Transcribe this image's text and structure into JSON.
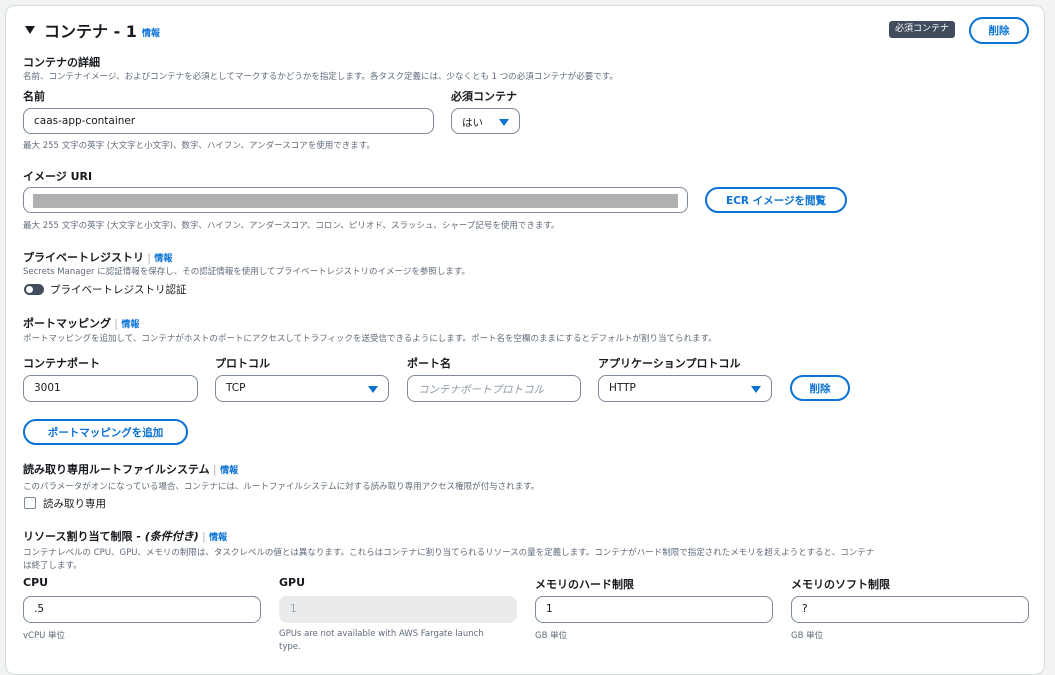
{
  "header": {
    "title": "コンテナ - 1",
    "info": "情報",
    "badge": "必須コンテナ",
    "delete_label": "削除"
  },
  "details": {
    "title": "コンテナの詳細",
    "description": "名前、コンテナイメージ、およびコンテナを必須としてマークするかどうかを指定します。各タスク定義には、少なくとも 1 つの必須コンテナが必要です。"
  },
  "name": {
    "label": "名前",
    "value": "caas-app-container",
    "hint": "最大 255 文字の英字 (大文字と小文字)、数字、ハイフン、アンダースコアを使用できます。"
  },
  "essential": {
    "label": "必須コンテナ",
    "value": "はい"
  },
  "image": {
    "label": "イメージ URI",
    "browse_label": "ECR イメージを閲覧",
    "hint": "最大 255 文字の英字 (大文字と小文字)、数字、ハイフン、アンダースコア、コロン、ピリオド、スラッシュ、シャープ記号を使用できます。"
  },
  "private_registry": {
    "title": "プライベートレジストリ",
    "info": "情報",
    "description": "Secrets Manager に認証情報を保存し、その認証情報を使用してプライベートレジストリのイメージを参照します。",
    "toggle_label": "プライベートレジストリ認証"
  },
  "port_mapping": {
    "title": "ポートマッピング",
    "info": "情報",
    "description": "ポートマッピングを追加して、コンテナがホストのポートにアクセスしてトラフィックを送受信できるようにします。ポート名を空欄のままにするとデフォルトが割り当てられます。",
    "container_port_label": "コンテナポート",
    "container_port_value": "3001",
    "protocol_label": "プロトコル",
    "protocol_value": "TCP",
    "port_name_label": "ポート名",
    "port_name_placeholder": "コンテナポートプロトコル",
    "app_protocol_label": "アプリケーションプロトコル",
    "app_protocol_value": "HTTP",
    "remove_label": "削除",
    "add_label": "ポートマッピングを追加"
  },
  "readonly_fs": {
    "title": "読み取り専用ルートファイルシステム",
    "info": "情報",
    "description": "このパラメータがオンになっている場合、コンテナには、ルートファイルシステムに対する読み取り専用アクセス権限が付与されます。",
    "checkbox_label": "読み取り専用"
  },
  "resources": {
    "title_main": "リソース割り当て制限 - ",
    "title_conditional": "(条件付き)",
    "info": "情報",
    "description_line1": "コンテナレベルの CPU、GPU、メモリの制限は、タスクレベルの値とは異なります。これらはコンテナに割り当てられるリソースの量を定義します。コンテナがハード制限で指定されたメモリを超えようとすると、コンテナ",
    "description_line2": "は終了します。",
    "cpu_label": "CPU",
    "cpu_value": ".5",
    "cpu_hint": "vCPU 単位",
    "gpu_label": "GPU",
    "gpu_value": "1",
    "gpu_hint_line1": "GPUs are not available with AWS Fargate launch",
    "gpu_hint_line2": "type.",
    "mem_hard_label": "メモリのハード制限",
    "mem_hard_value": "1",
    "mem_hard_hint": "GB 単位",
    "mem_soft_label": "メモリのソフト制限",
    "mem_soft_value": "?",
    "mem_soft_hint": "GB 単位"
  },
  "colors": {
    "accent": "#0972d3",
    "badge_bg": "#414d5c",
    "text": "#16191f",
    "muted": "#5f6b7a"
  },
  "icons": {
    "collapse": "caret-down-icon",
    "select": "caret-down-icon"
  }
}
